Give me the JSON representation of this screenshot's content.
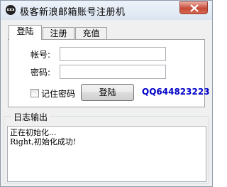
{
  "window": {
    "title": "极客新浪邮箱账号注册机",
    "icon": "ninja-avatar-icon",
    "close_icon": "close-icon",
    "close_color": "#c74a38"
  },
  "tabs": [
    {
      "label": "登陆",
      "active": true
    },
    {
      "label": "注册",
      "active": false
    },
    {
      "label": "充值",
      "active": false
    }
  ],
  "login": {
    "account_label": "帐号:",
    "account_value": "",
    "password_label": "密码:",
    "password_value": "",
    "remember_label": "记住密码",
    "remember_checked": false,
    "login_button": "登陆",
    "qq_text": "QQ644823223",
    "qq_color": "#0000c8"
  },
  "log": {
    "title": "日志输出",
    "lines": [
      "正在初始化...",
      "Right,初始化成功!"
    ]
  }
}
